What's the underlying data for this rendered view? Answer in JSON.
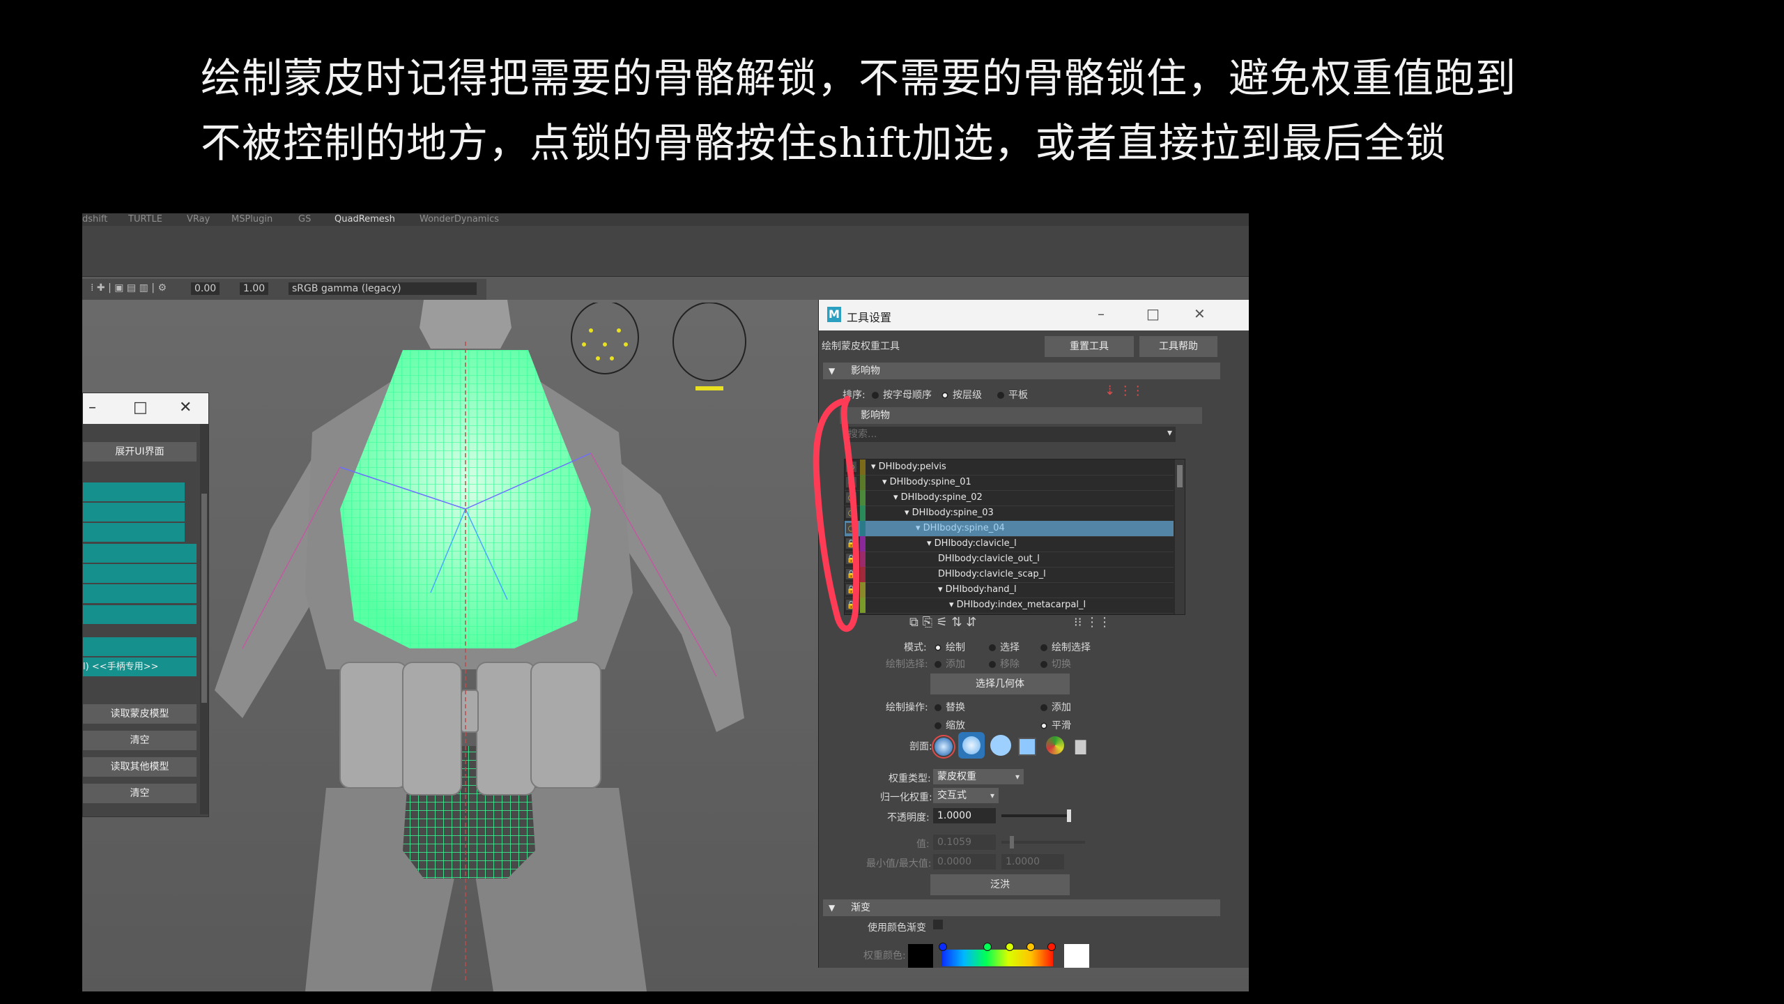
{
  "caption": {
    "line1": "绘制蒙皮时记得把需要的骨骼解锁，不需要的骨骼锁住，避免权重值跑到",
    "line2": "不被控制的地方，点锁的骨骼按住shift加选，或者直接拉到最后全锁"
  },
  "shelf_tabs": [
    "dshift",
    "TURTLE",
    "VRay",
    "MSPlugin",
    "GS",
    "QuadRemesh",
    "WonderDynamics"
  ],
  "toolbar": {
    "val1": "0.00",
    "val2": "1.00",
    "colorspace": "sRGB gamma (legacy)"
  },
  "left_window": {
    "expand_label": "展开UI界面",
    "teal_label": "l) <<手柄专用>>",
    "read_skin_model": "读取蒙皮模型",
    "clear1": "清空",
    "read_other_model": "读取其他模型",
    "clear2": "清空"
  },
  "tool_window": {
    "title": "工具设置",
    "tool_name": "绘制蒙皮权重工具",
    "reset_tool": "重置工具",
    "tool_help": "工具帮助",
    "section_influences": "影响物",
    "sort_label": "排序:",
    "sort_options": [
      "按字母顺序",
      "按层级",
      "平板"
    ],
    "sort_selected": 1,
    "influences_header": "影响物",
    "search_placeholder": "搜索...",
    "joints": [
      {
        "name": "DHIbody:pelvis",
        "indent": 0,
        "arrow": "▾",
        "color": "#7a6a1a"
      },
      {
        "name": "DHIbody:spine_01",
        "indent": 1,
        "arrow": "▾",
        "color": "#5a7a2a"
      },
      {
        "name": "DHIbody:spine_02",
        "indent": 2,
        "arrow": "▾",
        "color": "#4a8a3a"
      },
      {
        "name": "DHIbody:spine_03",
        "indent": 3,
        "arrow": "▾",
        "color": "#2a8a5a"
      },
      {
        "name": "DHIbody:spine_04",
        "indent": 4,
        "arrow": "▾",
        "color": "#2a7a8a"
      },
      {
        "name": "DHIbody:clavicle_l",
        "indent": 5,
        "arrow": "▾",
        "color": "#8a2a9a"
      },
      {
        "name": "DHIbody:clavicle_out_l",
        "indent": 6,
        "arrow": "",
        "color": "#9a2a6a"
      },
      {
        "name": "DHIbody:clavicle_scap_l",
        "indent": 6,
        "arrow": "",
        "color": "#a02a3a"
      },
      {
        "name": "DHIbody:hand_l",
        "indent": 6,
        "arrow": "▾",
        "color": "#8a8a2a"
      },
      {
        "name": "DHIbody:index_metacarpal_l",
        "indent": 7,
        "arrow": "▾",
        "color": "#7a9a2a"
      }
    ],
    "selected_joint": 4,
    "mode_label": "模式:",
    "mode_options": [
      "绘制",
      "选择",
      "绘制选择"
    ],
    "paint_select_label": "绘制选择:",
    "paint_select_options": [
      "添加",
      "移除",
      "切换"
    ],
    "select_geometry": "选择几何体",
    "paint_op_label": "绘制操作:",
    "paint_ops": [
      "替换",
      "添加",
      "缩放",
      "平滑"
    ],
    "profile_label": "剖面:",
    "weight_type_label": "权重类型:",
    "weight_type_value": "蒙皮权重",
    "normalize_label": "归一化权重:",
    "normalize_value": "交互式",
    "opacity_label": "不透明度:",
    "opacity_value": "1.0000",
    "opacity_fraction": 1.0,
    "value_label": "值:",
    "value_value": "0.1059",
    "value_fraction": 0.106,
    "minmax_label": "最小值/最大值:",
    "min_value": "0.0000",
    "max_value": "1.0000",
    "flood": "泛洪",
    "section_gradient": "渐变",
    "use_color_ramp": "使用颜色渐变",
    "weight_color_label": "权重颜色:"
  },
  "colors": {
    "teal": "#16908c",
    "wire": "#3dff9a",
    "selected_row": "#5285a6",
    "annotation": "#ff3b55"
  }
}
